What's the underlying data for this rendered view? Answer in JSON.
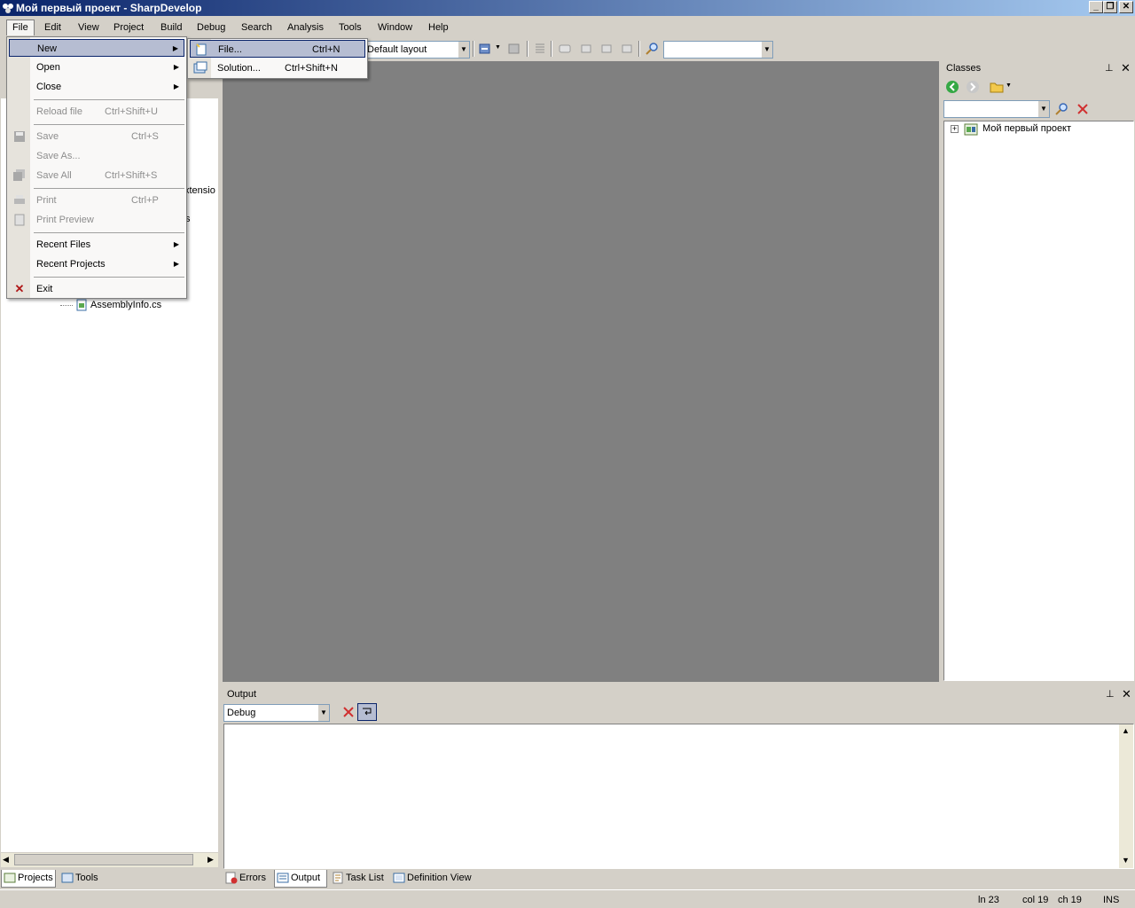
{
  "window": {
    "title": "Мой первый проект - SharpDevelop"
  },
  "menubar": [
    "File",
    "Edit",
    "View",
    "Project",
    "Build",
    "Debug",
    "Search",
    "Analysis",
    "Tools",
    "Window",
    "Help"
  ],
  "toolbar": {
    "layout_value": "Default layout",
    "search_value": ""
  },
  "file_menu": {
    "new": "New",
    "open": "Open",
    "close": "Close",
    "reload": "Reload file",
    "reload_sc": "Ctrl+Shift+U",
    "save": "Save",
    "save_sc": "Ctrl+S",
    "save_as": "Save As...",
    "save_all": "Save All",
    "save_all_sc": "Ctrl+Shift+S",
    "print": "Print",
    "print_sc": "Ctrl+P",
    "print_preview": "Print Preview",
    "recent_files": "Recent Files",
    "recent_projects": "Recent Projects",
    "exit": "Exit"
  },
  "new_submenu": {
    "file": "File...",
    "file_sc": "Ctrl+N",
    "solution": "Solution...",
    "solution_sc": "Ctrl+Shift+N"
  },
  "left_pad": {
    "partial_text_1": "xtensio",
    "partial_text_2": "s",
    "assembly_file": "AssemblyInfo.cs"
  },
  "classes_pad": {
    "title": "Classes",
    "search_value": "",
    "tree_root": "Мой первый проект"
  },
  "output_pad": {
    "title": "Output",
    "category": "Debug",
    "content": ""
  },
  "bottom_tabs_left": [
    {
      "label": "Projects",
      "active": true
    },
    {
      "label": "Tools",
      "active": false
    }
  ],
  "bottom_tabs_right": [
    {
      "label": "Errors",
      "active": false
    },
    {
      "label": "Output",
      "active": true
    },
    {
      "label": "Task List",
      "active": false
    },
    {
      "label": "Definition View",
      "active": false
    }
  ],
  "statusbar": {
    "ln": "ln 23",
    "col": "col 19",
    "ch": "ch 19",
    "mode": "INS"
  },
  "colors": {
    "title_start": "#0a246a",
    "title_end": "#a6caf0",
    "face": "#d4d0c8",
    "editor_bg": "#808080",
    "highlight": "#b6bdd2"
  }
}
